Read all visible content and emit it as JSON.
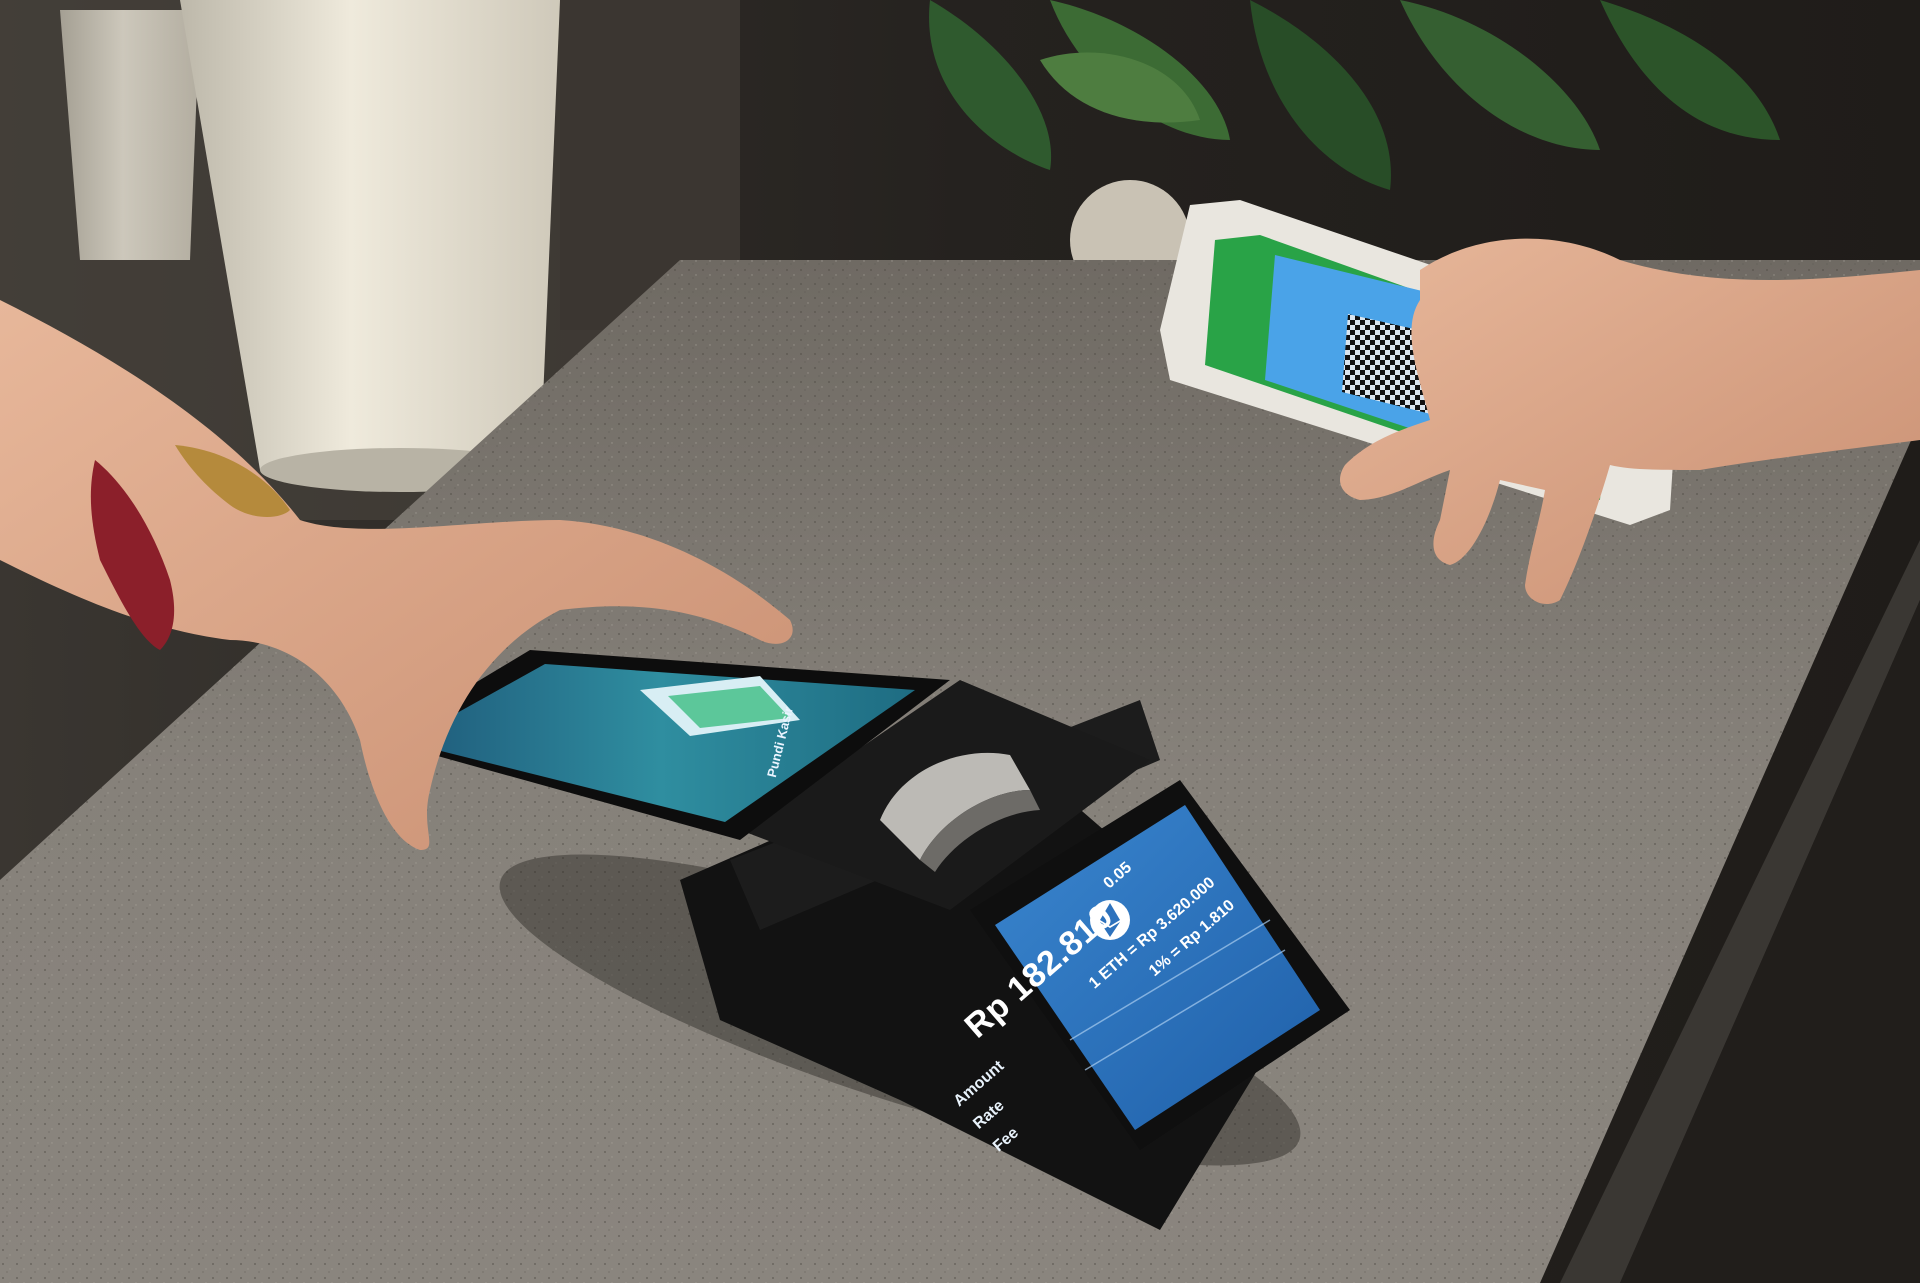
{
  "photo": {
    "description_colors": {
      "counter": "#7b7670",
      "terminal_body": "#141414",
      "customer_display": "#2d72bd",
      "phone_screen_green": "#29a347",
      "phone_screen_blue": "#4aa3e8"
    }
  },
  "terminal": {
    "main_screen": {
      "app_title": "Pundi Kasir"
    },
    "customer_display": {
      "icon": "ethereum-icon",
      "amount": "Rp 182.810",
      "eth_quantity": "0.05",
      "labels": {
        "amount": "Amount",
        "rate": "Rate",
        "fee": "Fee"
      },
      "rate_value": "1 ETH = Rp 3.620.000",
      "fee_value": "1% = Rp 1.810"
    }
  },
  "smartphone": {
    "screen": "qr-code"
  }
}
